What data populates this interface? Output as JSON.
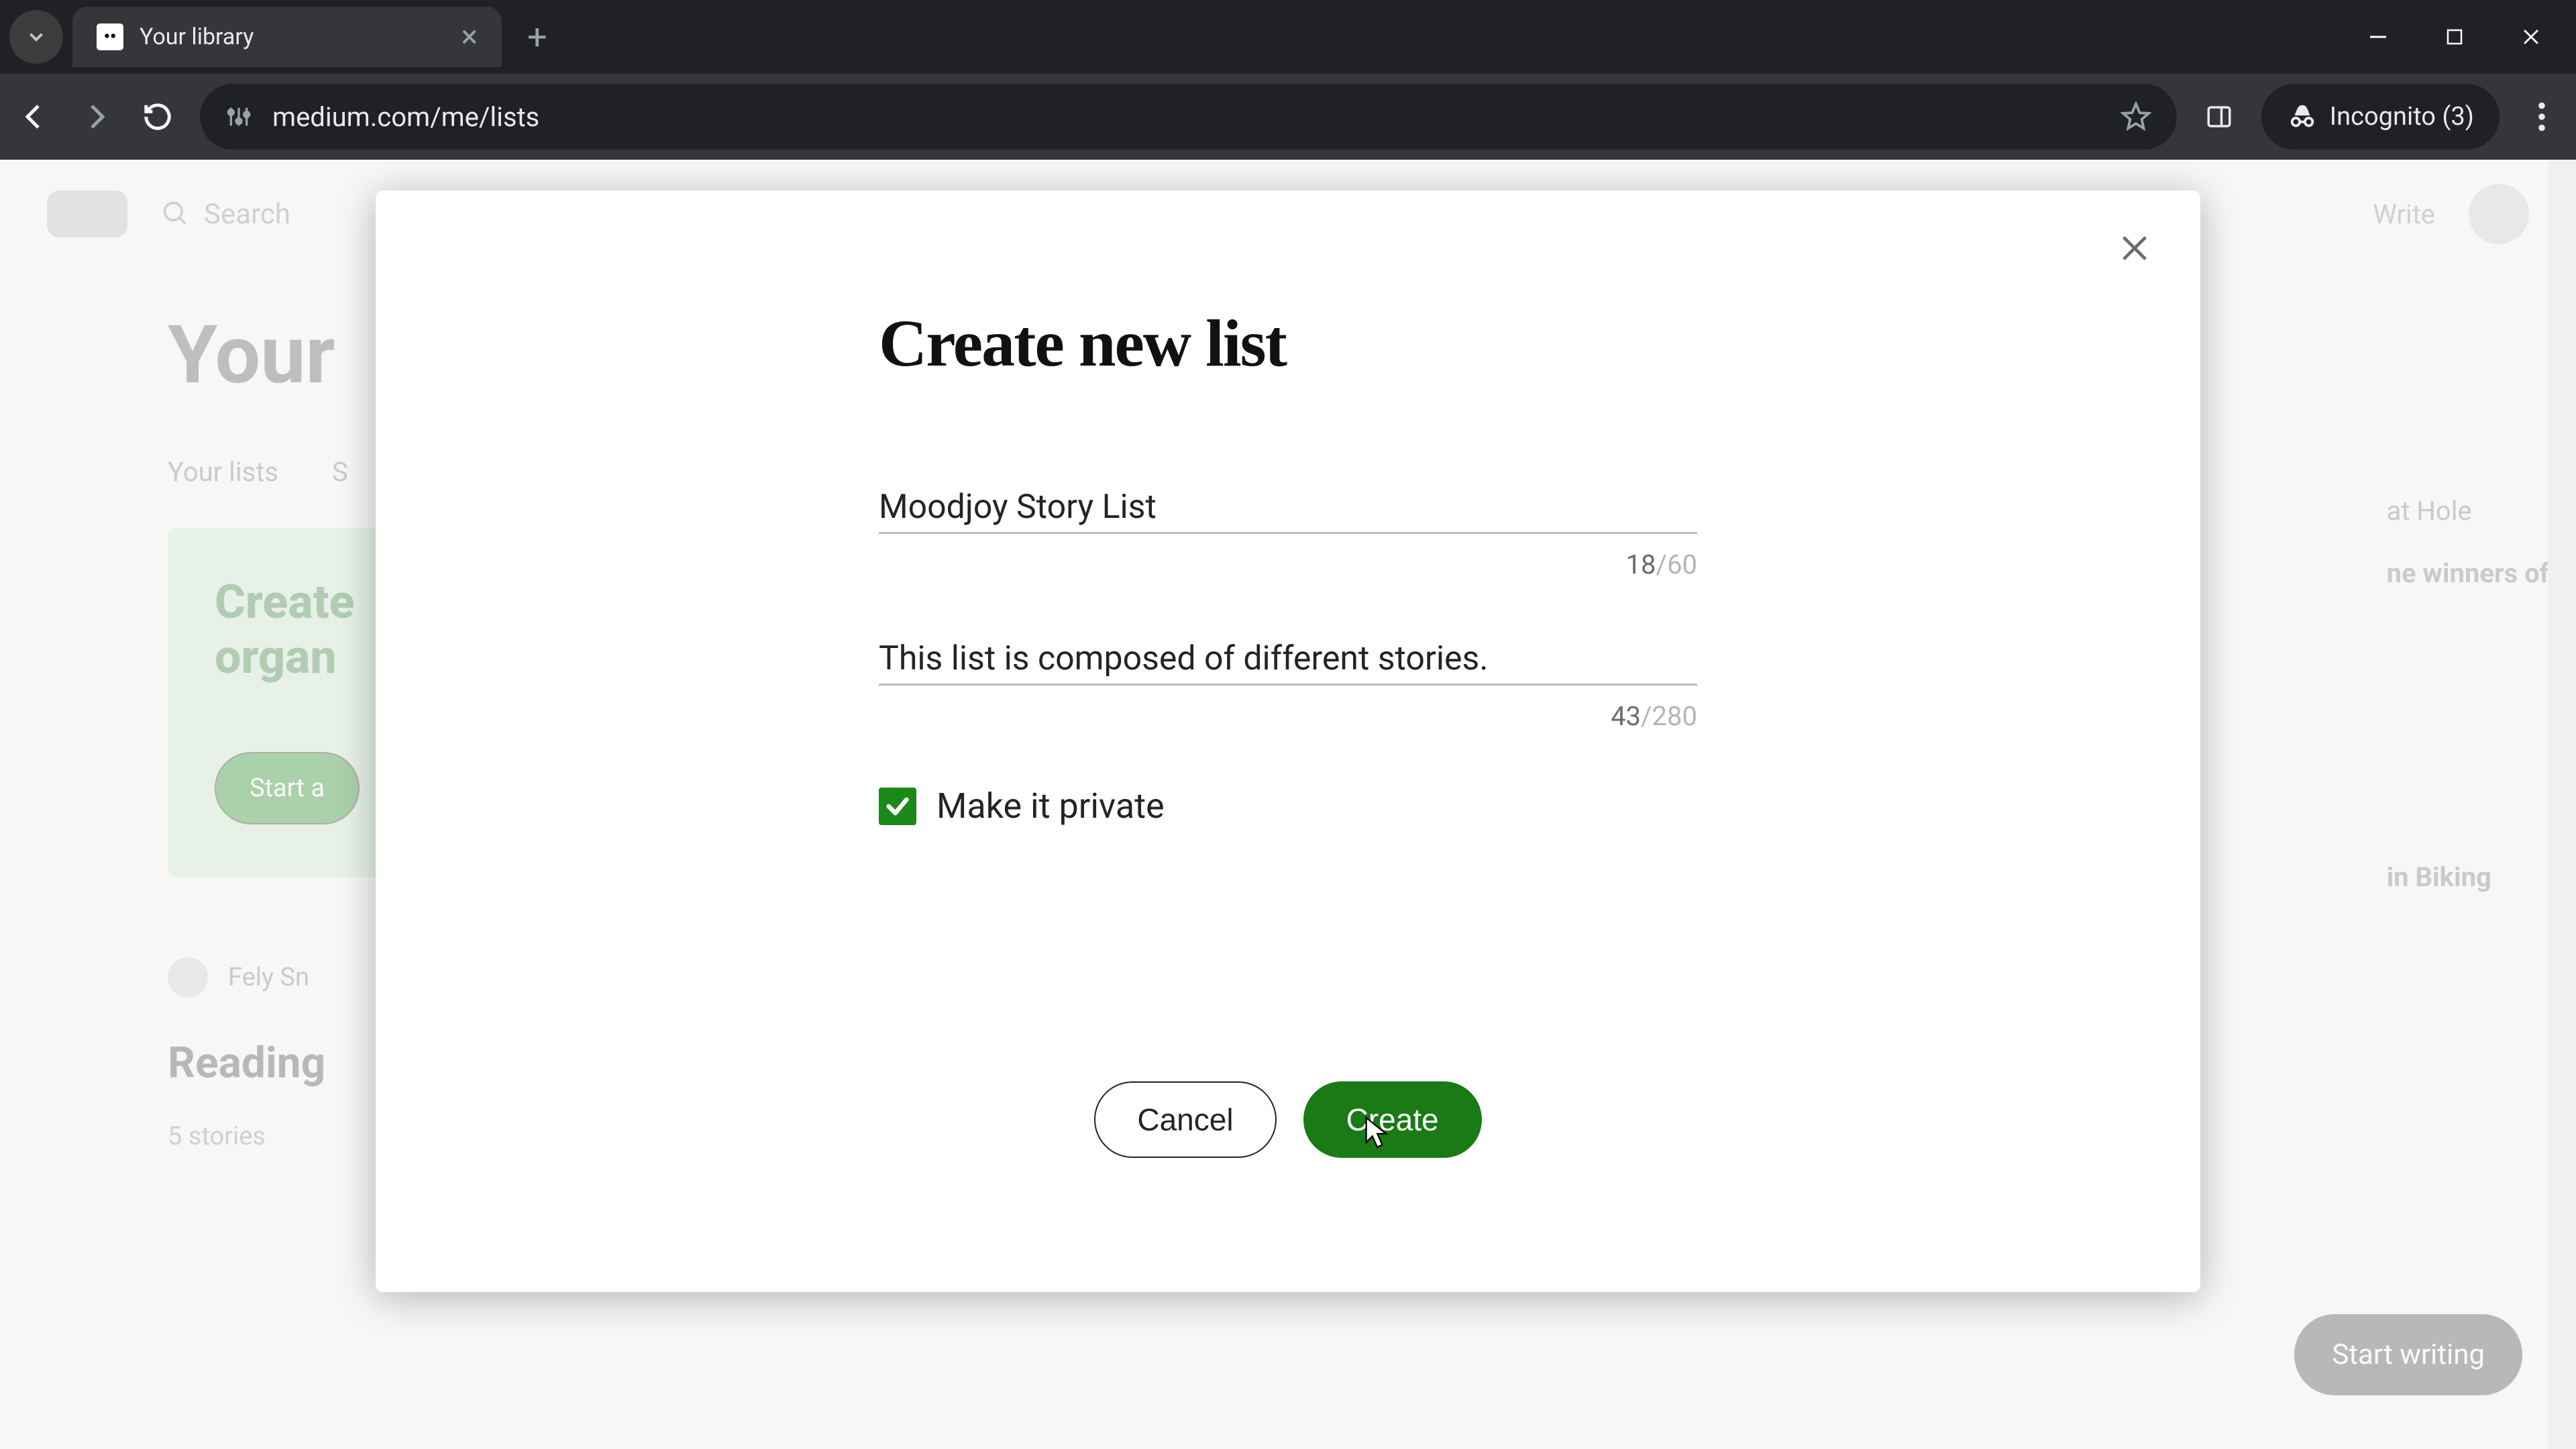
{
  "browser": {
    "tab_title": "Your library",
    "url": "medium.com/me/lists",
    "incognito_label": "Incognito (3)"
  },
  "backdrop": {
    "page_title": "Your",
    "search_placeholder": "Search",
    "write_label": "Write",
    "tab1": "Your lists",
    "card_line1": "Create",
    "card_line2": "organ",
    "card_btn": "Start a",
    "reading_label": "Reading",
    "stories_label": "5 stories",
    "side1": "at Hole",
    "side2": "ne winners of",
    "side3": "in Biking",
    "start_writing": "Start writing",
    "author_hint": "Fely Sn"
  },
  "modal": {
    "title": "Create new list",
    "name_value": "Moodjoy Story List",
    "name_count": "18",
    "name_max": "/60",
    "desc_value": "This list is composed of different stories.",
    "desc_count": "43",
    "desc_max": "/280",
    "private_label": "Make it private",
    "private_checked": true,
    "cancel_label": "Cancel",
    "create_label": "Create"
  }
}
